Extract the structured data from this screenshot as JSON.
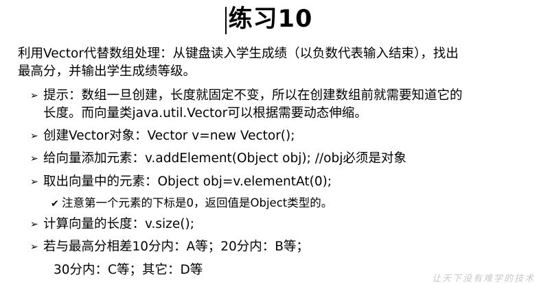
{
  "title": "练习10",
  "intro": {
    "line1": "利用Vector代替数组处理：从键盘读入学生成绩（以负数代表输入结束），找出",
    "line2": "最高分，并输出学生成绩等级。"
  },
  "bullets": {
    "tip_line1": "提示：数组一旦创建，长度就固定不变，所以在创建数组前就需要知道它的",
    "tip_line2": "长度。而向量类java.util.Vector可以根据需要动态伸缩。",
    "create": "创建Vector对象：Vector v=new Vector();",
    "add": "给向量添加元素：v.addElement(Object obj);   //obj必须是对象",
    "get": "取出向量中的元素：Object  obj=v.elementAt(0);",
    "get_note": "注意第一个元素的下标是0，返回值是Object类型的。",
    "size": "计算向量的长度：v.size();",
    "grade_line1": "若与最高分相差10分内：A等；20分内：B等；",
    "grade_line2": "30分内：C等；其它：D等"
  },
  "watermark": "让天下没有难学的技术"
}
